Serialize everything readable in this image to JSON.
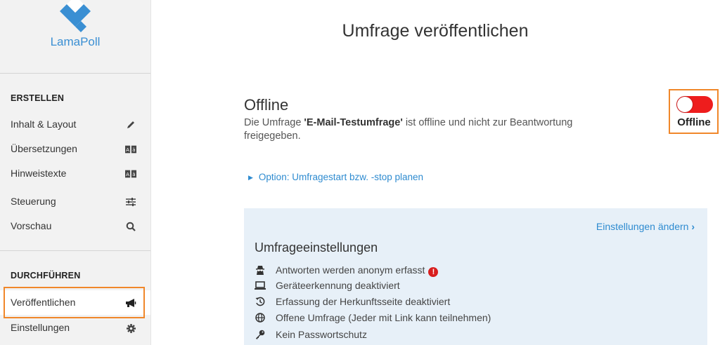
{
  "app": {
    "logo_text": "LamaPoll",
    "accent_color": "#3a8fd3",
    "highlight_color": "#f0872a"
  },
  "sidebar": {
    "sections": [
      {
        "heading": "ERSTELLEN",
        "items": [
          {
            "label": "Inhalt & Layout",
            "icon": "pencil-icon"
          },
          {
            "label": "Übersetzungen",
            "icon": "translate-icon"
          },
          {
            "label": "Hinweistexte",
            "icon": "translate-icon"
          },
          {
            "label": "Steuerung",
            "icon": "sliders-icon"
          },
          {
            "label": "Vorschau",
            "icon": "search-icon"
          }
        ]
      },
      {
        "heading": "DURCHFÜHREN",
        "items": [
          {
            "label": "Veröffentlichen",
            "icon": "megaphone-icon",
            "active": true
          },
          {
            "label": "Einstellungen",
            "icon": "gear-icon"
          }
        ]
      }
    ]
  },
  "main": {
    "title": "Umfrage veröffentlichen",
    "status": {
      "heading": "Offline",
      "desc_prefix": "Die Umfrage ",
      "survey_name": "'E-Mail-Testumfrage'",
      "desc_suffix": " ist offline und nicht zur Beantwortung freigegeben.",
      "toggle_label": "Offline",
      "toggle_on": false,
      "toggle_color": "#ee1d1d"
    },
    "option_link": "Option: Umfragestart bzw. -stop planen",
    "settings": {
      "change_link": "Einstellungen ändern",
      "title": "Umfrageeinstellungen",
      "items": [
        {
          "text": "Antworten werden anonym erfasst",
          "icon": "spy-icon",
          "warning": true
        },
        {
          "text": "Geräteerkennung deaktiviert",
          "icon": "laptop-icon"
        },
        {
          "text": "Erfassung der Herkunftsseite deaktiviert",
          "icon": "history-icon"
        },
        {
          "text": "Offene Umfrage (Jeder mit Link kann teilnehmen)",
          "icon": "globe-icon"
        },
        {
          "text": "Kein Passwortschutz",
          "icon": "key-icon"
        }
      ]
    }
  }
}
